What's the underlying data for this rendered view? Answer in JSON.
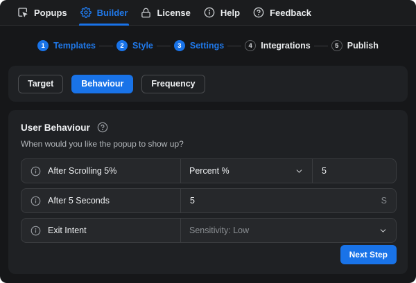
{
  "colors": {
    "accent_blue": "#1973e8",
    "window_bg": "#161719",
    "card_bg": "#1f2124",
    "row_bg": "#26282b"
  },
  "topbar": {
    "items": [
      {
        "label": "Popups",
        "icon": "popups-cursor-icon",
        "active": false
      },
      {
        "label": "Builder",
        "icon": "gear-icon",
        "active": true
      },
      {
        "label": "License",
        "icon": "lock-icon",
        "active": false
      },
      {
        "label": "Help",
        "icon": "info-circle-icon",
        "active": false
      },
      {
        "label": "Feedback",
        "icon": "question-circle-icon",
        "active": false
      }
    ]
  },
  "stepper": {
    "steps": [
      {
        "number": "1",
        "label": "Templates",
        "state": "done"
      },
      {
        "number": "2",
        "label": "Style",
        "state": "done"
      },
      {
        "number": "3",
        "label": "Settings",
        "state": "done"
      },
      {
        "number": "4",
        "label": "Integrations",
        "state": "todo"
      },
      {
        "number": "5",
        "label": "Publish",
        "state": "todo"
      }
    ]
  },
  "tabs": {
    "items": [
      {
        "label": "Target",
        "active": false
      },
      {
        "label": "Behaviour",
        "active": true
      },
      {
        "label": "Frequency",
        "active": false
      }
    ]
  },
  "panel": {
    "title": "User Behaviour",
    "subtitle": "When would you like the popup to show up?",
    "rows": [
      {
        "label": "After Scrolling 5%",
        "select_value": "Percent %",
        "input_value": "5"
      },
      {
        "label": "After 5 Seconds",
        "input_value": "5",
        "suffix": "S"
      },
      {
        "label": "Exit Intent",
        "select_placeholder": "Sensitivity: Low"
      }
    ],
    "next_button": "Next Step"
  }
}
